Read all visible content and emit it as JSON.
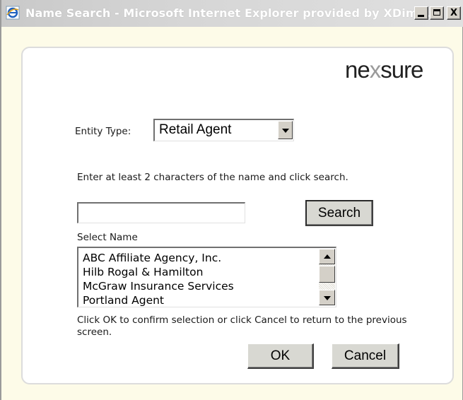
{
  "window": {
    "title": "Name Search - Microsoft Internet Explorer provided by XDim...",
    "app_icon": "ie-icon",
    "controls": {
      "minimize_icon": "minimize-icon",
      "maximize_icon": "maximize-icon",
      "close_label": "X"
    }
  },
  "brand": {
    "logo_prefix": "ne",
    "logo_x": "x",
    "logo_suffix": "sure"
  },
  "form": {
    "entity_type_label": "Entity Type:",
    "entity_type_value": "Retail Agent",
    "instruction": "Enter at least 2 characters of the name and click search.",
    "search_input_value": "",
    "search_button": "Search",
    "select_name_label": "Select Name",
    "names": [
      "ABC Affiliate Agency, Inc.",
      "Hilb Rogal & Hamilton",
      "McGraw Insurance Services",
      "Portland Agent"
    ],
    "confirm_text": "Click OK to confirm selection or click Cancel to return to the previous screen.",
    "ok_button": "OK",
    "cancel_button": "Cancel"
  },
  "colors": {
    "window_background": "#fdfbe8",
    "panel_background": "#ffffff",
    "button_face": "#d8d8d2",
    "logo_x": "#9a9a9a"
  }
}
